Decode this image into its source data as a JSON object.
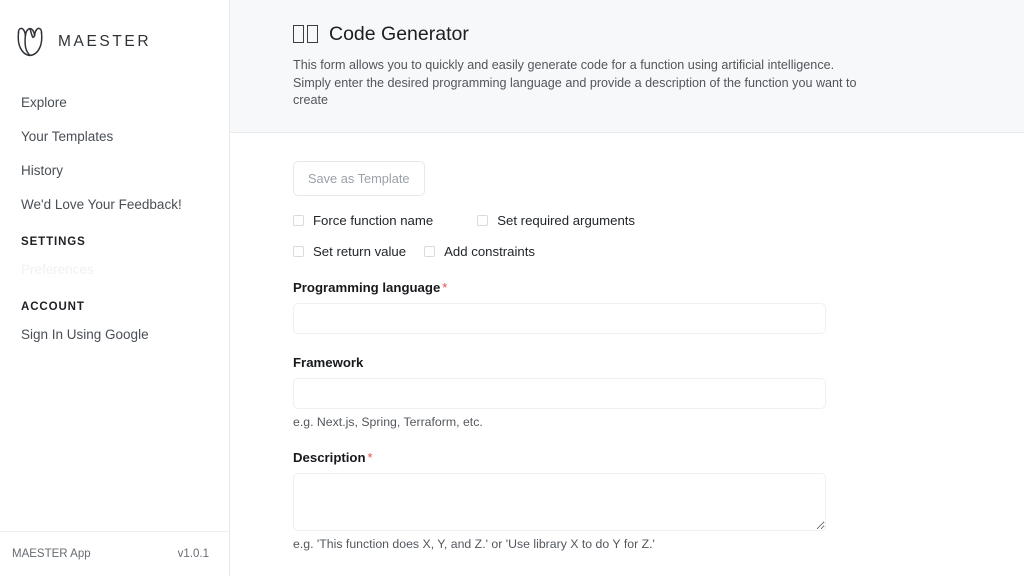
{
  "sidebar": {
    "brand": {
      "name": "MAESTER",
      "logo_icon": "tulip-logo-icon"
    },
    "items": [
      {
        "label": "Explore",
        "disabled": false
      },
      {
        "label": "Your Templates",
        "disabled": false
      },
      {
        "label": "History",
        "disabled": false
      },
      {
        "label": "We'd Love Your Feedback!",
        "disabled": false
      }
    ],
    "settings_section": {
      "header": "SETTINGS",
      "item": "Preferences"
    },
    "account_section": {
      "header": "ACCOUNT",
      "item": "Sign In Using Google"
    },
    "footer": {
      "app_name": "MAESTER App",
      "version": "v1.0.1"
    }
  },
  "header": {
    "title": "Code Generator",
    "title_icon_boxes": 2,
    "description": "This form allows you to quickly and easily generate code for a function using artificial intelligence. Simply enter the desired programming language and provide a description of the function you want to create"
  },
  "form": {
    "save_template_label": "Save as Template",
    "checkboxes": [
      {
        "label": "Force function name",
        "checked": false
      },
      {
        "label": "Set required arguments",
        "checked": false
      },
      {
        "label": "Set return value",
        "checked": false
      },
      {
        "label": "Add constraints",
        "checked": false
      }
    ],
    "fields": {
      "language": {
        "label": "Programming language",
        "required_marker": "*",
        "value": "",
        "placeholder": ""
      },
      "framework": {
        "label": "Framework",
        "value": "",
        "placeholder": "",
        "hint": "e.g. Next.js, Spring, Terraform, etc."
      },
      "description": {
        "label": "Description",
        "required_marker": "*",
        "value": "",
        "placeholder": "",
        "hint": "e.g. 'This function does X, Y, and Z.' or 'Use library X to do Y for Z.'"
      }
    }
  },
  "colors": {
    "accent_required": "#e0534f",
    "header_band": "#f7f8f9",
    "border": "#e9eaec",
    "text_primary": "#1b1e22",
    "text_muted": "#51565c"
  }
}
